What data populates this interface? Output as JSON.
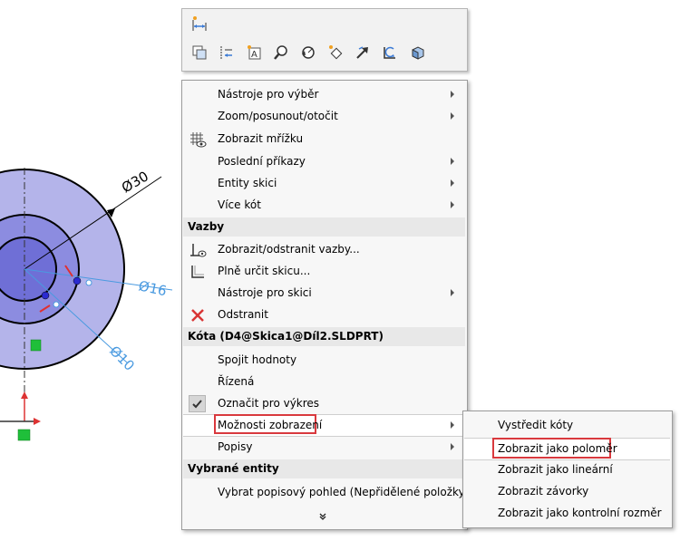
{
  "sketch": {
    "dim_outer": "30",
    "dim_middle": "16",
    "dim_inner": "10",
    "diameter_symbol": "Ø"
  },
  "toolbar": {
    "row1": [
      "smart-dimension-icon"
    ],
    "row2": [
      "copy-icon",
      "align-icon",
      "annotation-icon",
      "zoom-icon",
      "rotate-view-icon",
      "select-tool-icon",
      "pan-icon",
      "undo-view-icon",
      "view-cube-icon"
    ]
  },
  "menu": {
    "items_top": [
      {
        "label": "Nástroje pro výběr",
        "submenu": true
      },
      {
        "label": "Zoom/posunout/otočit",
        "submenu": true
      },
      {
        "label": "Zobrazit mřížku",
        "submenu": false,
        "icon": "grid-icon"
      },
      {
        "label": "Poslední příkazy",
        "submenu": true
      },
      {
        "label": "Entity skici",
        "submenu": true
      },
      {
        "label": "Více kót",
        "submenu": true
      }
    ],
    "section_relations": "Vazby",
    "items_relations": [
      {
        "label": "Zobrazit/odstranit vazby...",
        "icon": "relations-icon"
      },
      {
        "label": "Plně určit skicu...",
        "icon": "fully-define-icon"
      },
      {
        "label": "Nástroje pro skici",
        "submenu": true
      },
      {
        "label": "Odstranit",
        "icon": "delete-icon"
      }
    ],
    "section_dimension": "Kóta (D4@Skica1@Díl2.SLDPRT)",
    "items_dimension": [
      {
        "label": "Spojit hodnoty"
      },
      {
        "label": "Řízená"
      },
      {
        "label": "Označit pro výkres",
        "checked": true
      },
      {
        "label": "Možnosti zobrazení",
        "submenu": true,
        "highlighted": true
      },
      {
        "label": "Popisy",
        "submenu": true
      }
    ],
    "section_selected": "Vybrané entity",
    "items_selected": [
      {
        "label": "Vybrat popisový pohled (Nepřidělené položky)"
      }
    ],
    "expand_glyph": "»"
  },
  "submenu": {
    "items": [
      {
        "label": "Vystředit kóty"
      },
      {
        "label": "Zobrazit jako poloměr",
        "highlighted": true
      },
      {
        "label": "Zobrazit jako lineární"
      },
      {
        "label": "Zobrazit závorky"
      },
      {
        "label": "Zobrazit jako kontrolní rozměr"
      }
    ]
  },
  "colors": {
    "circle_outer": "#b4b4ea",
    "circle_mid": "#8c8ce0",
    "circle_inner": "#6f6fd6",
    "dimension_blue": "#4a9ae0",
    "highlight_red": "#d9393e"
  }
}
